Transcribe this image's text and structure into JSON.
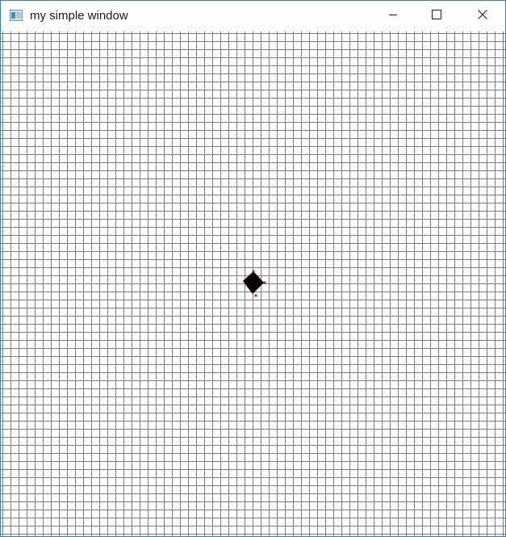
{
  "window": {
    "title": "my simple window",
    "icon": "app-window-icon",
    "controls": {
      "minimize_icon": "minimize-icon",
      "maximize_icon": "maximize-icon",
      "close_icon": "close-icon"
    }
  },
  "canvas": {
    "background": "#ffffff",
    "grid_line_color": "#7a7a7a",
    "shape_color": "#000000",
    "marker_color": "#d42020"
  }
}
